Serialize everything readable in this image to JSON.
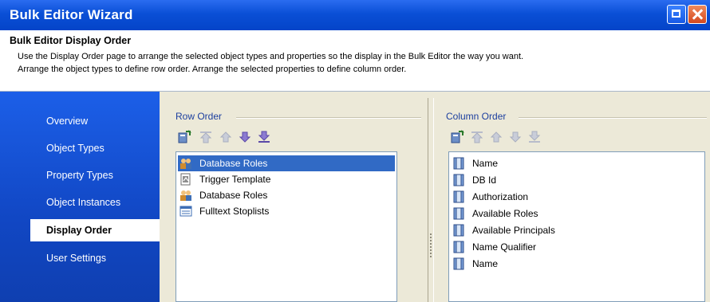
{
  "window": {
    "title": "Bulk Editor Wizard"
  },
  "header": {
    "title": "Bulk Editor Display Order",
    "description_line1": "Use the Display Order page to arrange the selected object types and properties so the display in the Bulk Editor the way you want.",
    "description_line2": "Arrange the object types to define row order. Arrange the selected properties to define column order."
  },
  "sidebar": {
    "items": [
      {
        "label": "Overview",
        "active": false
      },
      {
        "label": "Object Types",
        "active": false
      },
      {
        "label": "Property Types",
        "active": false
      },
      {
        "label": "Object Instances",
        "active": false
      },
      {
        "label": "Display Order",
        "active": true
      },
      {
        "label": "User Settings",
        "active": false
      }
    ]
  },
  "row_order": {
    "label": "Row Order",
    "toolbar": [
      "add-icon",
      "move-top-icon",
      "move-up-icon",
      "move-down-icon",
      "move-bottom-icon"
    ],
    "items": [
      {
        "label": "Database Roles",
        "icon": "database-roles-icon",
        "selected": true
      },
      {
        "label": "Trigger Template",
        "icon": "trigger-template-icon",
        "selected": false
      },
      {
        "label": "Database Roles",
        "icon": "database-roles-icon",
        "selected": false
      },
      {
        "label": "Fulltext Stoplists",
        "icon": "fulltext-stoplist-icon",
        "selected": false
      }
    ]
  },
  "column_order": {
    "label": "Column Order",
    "toolbar": [
      "add-icon",
      "move-top-icon",
      "move-up-icon",
      "move-down-icon",
      "move-bottom-icon"
    ],
    "items": [
      {
        "label": "Name"
      },
      {
        "label": "DB Id"
      },
      {
        "label": "Authorization"
      },
      {
        "label": "Available Roles"
      },
      {
        "label": "Available Principals"
      },
      {
        "label": "Name Qualifier"
      },
      {
        "label": "Name"
      }
    ]
  },
  "colors": {
    "titlebar": "#0a4fd6",
    "sidebar": "#1147c4",
    "selection": "#316ac5",
    "panel": "#ece9d8"
  }
}
